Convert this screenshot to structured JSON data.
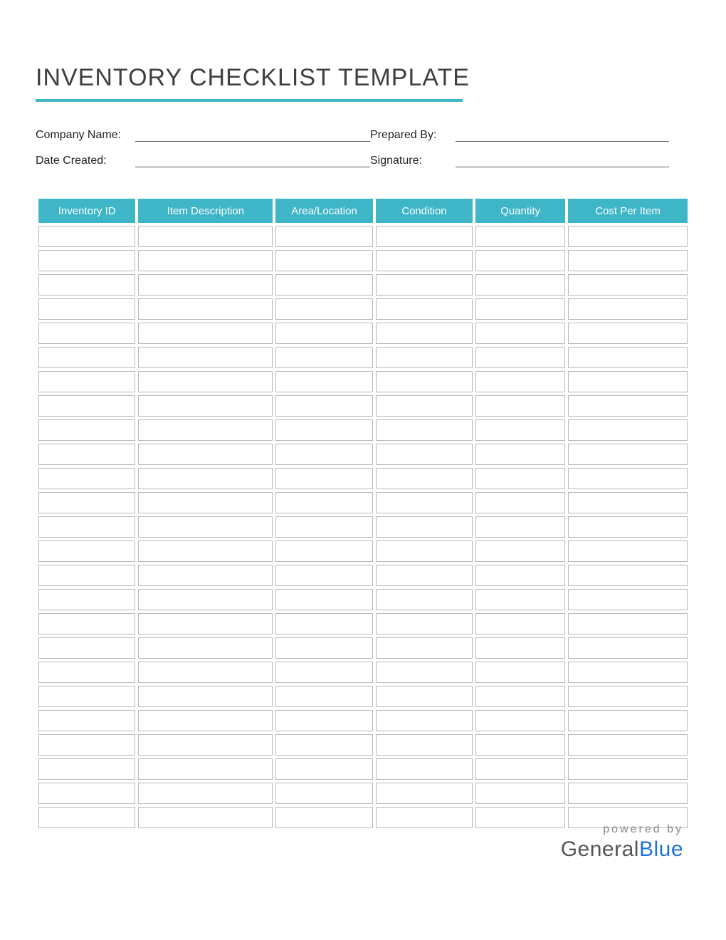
{
  "title": "INVENTORY CHECKLIST TEMPLATE",
  "meta": {
    "company_label": "Company Name:",
    "company_value": "",
    "date_label": "Date Created:",
    "date_value": "",
    "prepared_label": "Prepared By:",
    "prepared_value": "",
    "signature_label": "Signature:",
    "signature_value": ""
  },
  "table": {
    "headers": {
      "inventory_id": "Inventory ID",
      "item_description": "Item Description",
      "area_location": "Area/Location",
      "condition": "Condition",
      "quantity": "Quantity",
      "cost_per_item": "Cost Per Item"
    },
    "row_count": 25
  },
  "footer": {
    "powered": "powered by",
    "brand1": "General",
    "brand2": "Blue"
  },
  "colors": {
    "accent": "#3eb6c8",
    "brand_blue": "#1e74d8"
  }
}
